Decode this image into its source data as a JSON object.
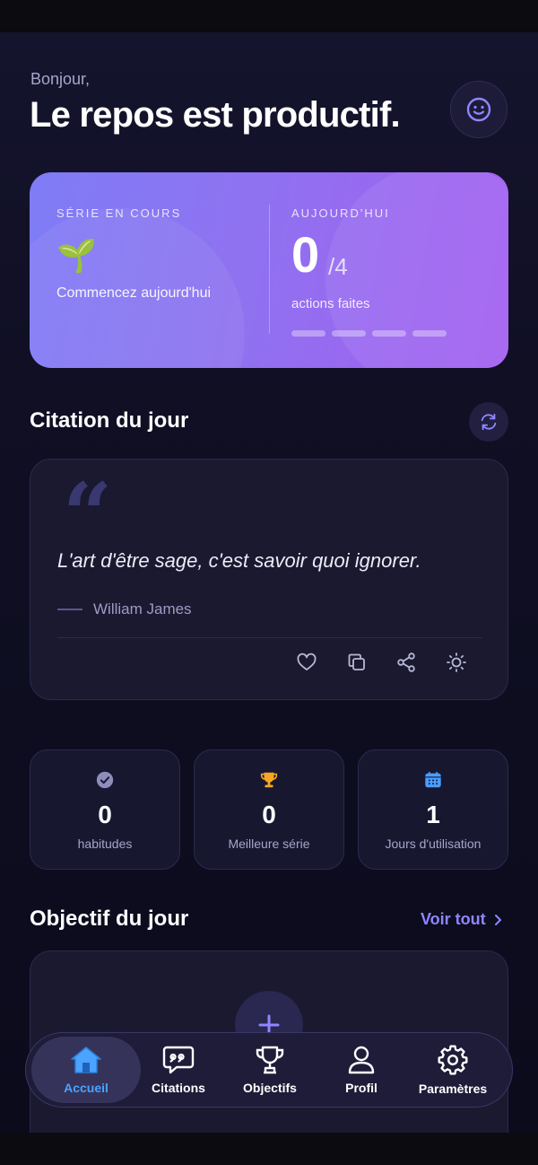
{
  "header": {
    "greeting": "Bonjour,",
    "title": "Le repos est productif."
  },
  "streak_card": {
    "streak_label": "SÉRIE EN COURS",
    "streak_emoji": "🌱",
    "streak_text": "Commencez aujourd'hui",
    "today_label": "AUJOURD'HUI",
    "done_count": "0",
    "total": "/4",
    "actions_text": "actions faites",
    "progress_done": 0,
    "progress_total": 4
  },
  "quote_section": {
    "title": "Citation du jour",
    "quote": "L'art d'être sage, c'est savoir quoi ignorer.",
    "author": "William James",
    "actions": [
      "heart-icon",
      "copy-icon",
      "share-icon",
      "brightness-icon"
    ]
  },
  "stats": [
    {
      "icon": "check-circle-icon",
      "value": "0",
      "label": "habitudes"
    },
    {
      "icon": "trophy-icon",
      "value": "0",
      "label": "Meilleure série"
    },
    {
      "icon": "calendar-icon",
      "value": "1",
      "label": "Jours d'utilisation"
    }
  ],
  "goal_section": {
    "title": "Objectif du jour",
    "see_all": "Voir tout"
  },
  "nav": {
    "items": [
      {
        "label": "Accueil",
        "icon": "home-icon",
        "active": true
      },
      {
        "label": "Citations",
        "icon": "quote-bubble-icon",
        "active": false
      },
      {
        "label": "Objectifs",
        "icon": "trophy-icon",
        "active": false
      },
      {
        "label": "Profil",
        "icon": "user-icon",
        "active": false
      },
      {
        "label": "Paramètres",
        "icon": "gear-icon",
        "active": false
      }
    ]
  },
  "colors": {
    "accent": "#8f86ff",
    "active_nav": "#4aa3ff",
    "hero_start": "#7f7cf6",
    "hero_end": "#a35ef0"
  }
}
